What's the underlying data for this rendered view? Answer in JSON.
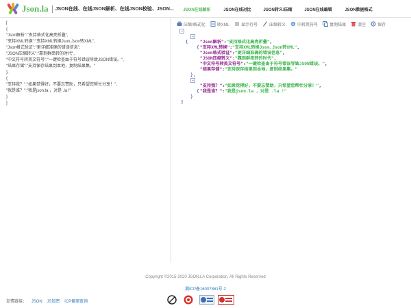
{
  "header": {
    "logo_text": "Json.la",
    "slogan": "JSON在线、在线JSON解析、在线JSON校验、JSON...",
    "nav": [
      {
        "label": "JSON在线解析",
        "active": true
      },
      {
        "label": "JSON在线对比",
        "active": false
      },
      {
        "label": "JSON转义/压缩",
        "active": false
      },
      {
        "label": "JSON在线编辑",
        "active": false
      },
      {
        "label": "JSON数据格式",
        "active": false
      }
    ]
  },
  "editor": {
    "text": "[\n{\n\"Json解析\":\"支持格式化高亮折叠\",\n\"支持XML转换\":\"支持XML转换Json,Json转XML\",\n\"Json格式验证\":\"更详细准确的错误信息\",\n\"JSON压缩转义\":\"靠到群串转的时代\",\n\"中文符号转英文符号\":\"一键检查由于符号错误导致JSON错误。\",\n\"结果存储\":\"支持保存结果到本地，复制结果集。\"\n},\n{\n\"支持我？\":\"如果觉得好，不要忘赞助，只希望您帮忙分享！\",\n\"我是谁？\":\"我是json.la ，对是 .la !\"\n}\n]"
  },
  "toolbar": {
    "items": [
      {
        "label": "压缩/格式化",
        "icon": "compress-icon"
      },
      {
        "label": "转XML",
        "icon": "xml-icon"
      },
      {
        "label": "显示行号",
        "icon": "line-number-icon"
      },
      {
        "label": "压缩转义",
        "icon": "escape-icon"
      },
      {
        "label": "中转英符号",
        "icon": "convert-icon"
      },
      {
        "label": "复制结果",
        "icon": "copy-icon"
      },
      {
        "label": "清空",
        "icon": "trash-icon"
      },
      {
        "label": "保存",
        "icon": "save-icon"
      }
    ]
  },
  "viewer": {
    "open_bracket": "[",
    "close_bracket": "]",
    "objects": [
      {
        "entries": [
          {
            "key": "\"Json解析\"",
            "value": "\"支持格式化高亮折叠\""
          },
          {
            "key": "\"支持XML转换\"",
            "value": "\"支持XML转换Json,Json转XML\""
          },
          {
            "key": "\"Json格式验证\"",
            "value": "\"更详细准确的错误信息\""
          },
          {
            "key": "\"JSON压缩转义\"",
            "value": "\"靠到群串转的时代\""
          },
          {
            "key": "\"中文符号转英文符号\"",
            "value": "\"一键检查由于符号错误导致JSON错误。\""
          },
          {
            "key": "\"结果存储\"",
            "value": "\"支持保存结果到本地，复制结果集。\""
          }
        ]
      },
      {
        "entries": [
          {
            "key": "\"支持我？\"",
            "value": "\"如果觉得好，不要忘赞助，只希望您帮忙分享！\""
          },
          {
            "key": "\"我是谁？\"",
            "value": "\"我是json.la ，对是 .la !\""
          }
        ]
      }
    ]
  },
  "footer": {
    "copyright": "Copyright ©2015-2020 JSON.LA Corporation, All Rights Reserved",
    "icp": "湘ICP备16007861号-2",
    "links_label": "友情链接：",
    "links": [
      "JSON",
      "JS加密",
      "ICP备案查询"
    ],
    "badges": [
      "ccc-badge",
      "trust-badge",
      "network-police-badge",
      "credit-badge"
    ]
  },
  "colors": {
    "accent": "#5cb85c",
    "key": "#92278f",
    "value": "#3ab54a",
    "bracket": "#1a1aa6",
    "link": "#337ab7"
  }
}
